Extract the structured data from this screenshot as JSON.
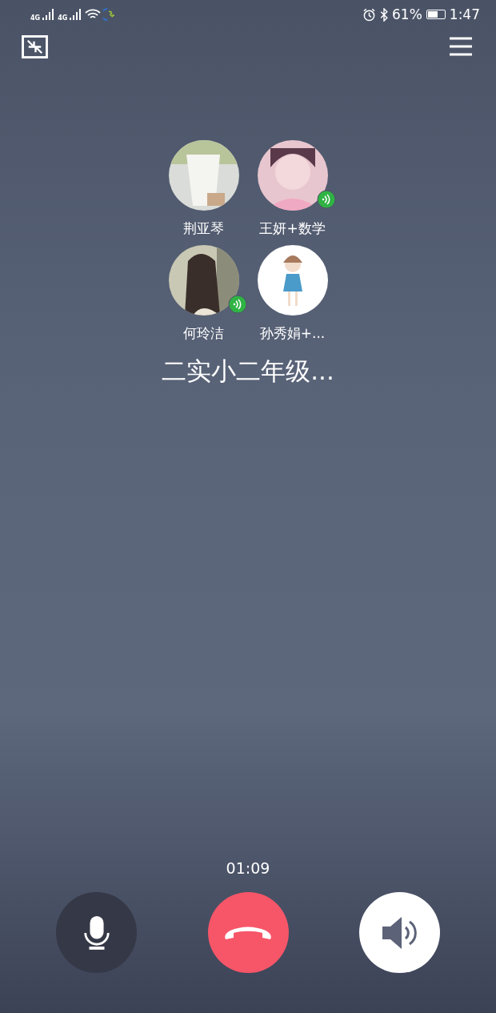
{
  "status_bar": {
    "network_1": "4G",
    "network_2": "4G",
    "battery_percent": "61%",
    "time": "1:47"
  },
  "participants": [
    {
      "name": "荆亚琴",
      "speaking": false
    },
    {
      "name": "王妍+数学",
      "speaking": true
    },
    {
      "name": "何玲洁",
      "speaking": true
    },
    {
      "name": "孙秀娟+...",
      "speaking": false
    }
  ],
  "group_name": "二实小二年级...",
  "timer": "01:09",
  "controls": {
    "mute": {
      "on": false
    },
    "speaker": {
      "on": true
    }
  }
}
